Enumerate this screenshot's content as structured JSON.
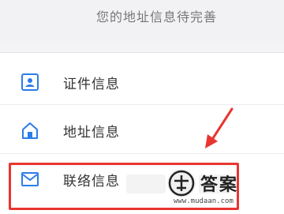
{
  "notice": {
    "text": "您的地址信息待完善"
  },
  "menu": {
    "items": [
      {
        "label": "证件信息",
        "icon": "id-card-icon"
      },
      {
        "label": "地址信息",
        "icon": "home-icon"
      },
      {
        "label": "联络信息",
        "icon": "envelope-icon"
      }
    ]
  },
  "colors": {
    "accent": "#2b7de9",
    "highlight": "#e8362f"
  },
  "watermark": {
    "title": "答案",
    "url": "www.mudaan.com"
  }
}
